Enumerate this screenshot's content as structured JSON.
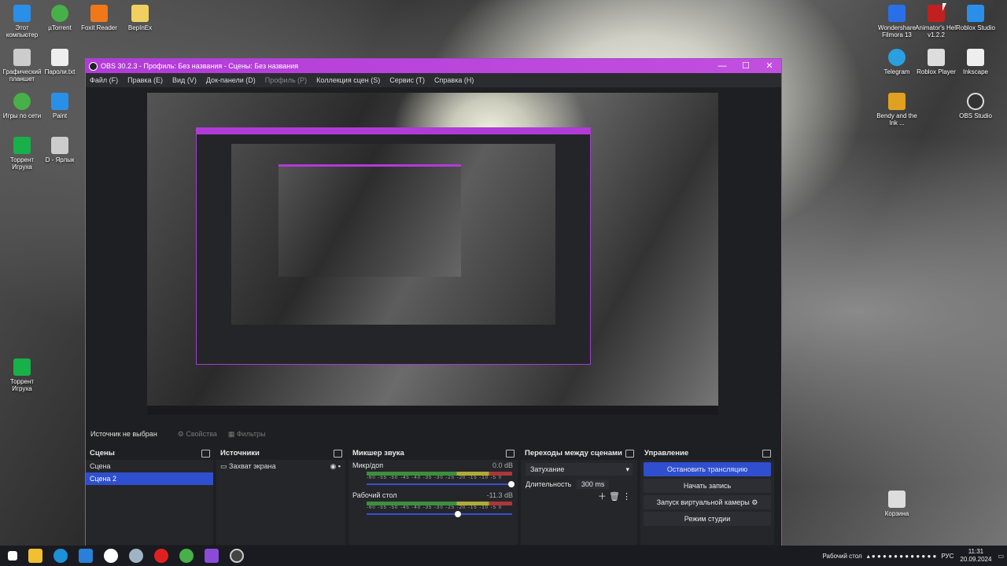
{
  "desktop": {
    "icons_left": [
      {
        "label": "Этот компьютер",
        "color": "#2a8fe8"
      },
      {
        "label": "µTorrent",
        "color": "#48b048"
      },
      {
        "label": "Foxit Reader",
        "color": "#f07818"
      },
      {
        "label": "BepInEx",
        "color": "#f0d060"
      },
      {
        "label": "Графический планшет",
        "color": "#cccccc"
      },
      {
        "label": "Пароли.txt",
        "color": "#eeeeee"
      },
      {
        "label": "Игры по сети",
        "color": "#48b048"
      },
      {
        "label": "Paint",
        "color": "#2a8fe8"
      },
      {
        "label": "Торрент Игруха",
        "color": "#18b048"
      },
      {
        "label": "D - Ярлык",
        "color": "#cccccc"
      },
      {
        "label": "Торрент Игруха",
        "color": "#18b048"
      }
    ],
    "icons_right": [
      {
        "label": "Wondershare Filmora 13",
        "color": "#2a6fe8"
      },
      {
        "label": "Animator's Hell v1.2.2",
        "color": "#c02020"
      },
      {
        "label": "Roblox Studio",
        "color": "#2a8fe8"
      },
      {
        "label": "Telegram",
        "color": "#2aa0e0"
      },
      {
        "label": "Roblox Player",
        "color": "#dddddd"
      },
      {
        "label": "Inkscape",
        "color": "#eeeeee"
      },
      {
        "label": "Bendy and the Ink ...",
        "color": "#e0a020"
      },
      {
        "label": "OBS Studio",
        "color": "#333333"
      },
      {
        "label": "Корзина",
        "color": "#dddddd"
      }
    ]
  },
  "window": {
    "title": "OBS 30.2.3 - Профиль: Без названия - Сцены: Без названия",
    "minimize": "—",
    "maximize": "☐",
    "close": "✕",
    "menu": [
      {
        "label": "Файл (F)",
        "dim": false
      },
      {
        "label": "Правка (E)",
        "dim": false
      },
      {
        "label": "Вид (V)",
        "dim": false
      },
      {
        "label": "Док-панели (D)",
        "dim": false
      },
      {
        "label": "Профиль (P)",
        "dim": true
      },
      {
        "label": "Коллекция сцен (S)",
        "dim": false
      },
      {
        "label": "Сервис (T)",
        "dim": false
      },
      {
        "label": "Справка (H)",
        "dim": false
      }
    ]
  },
  "status": {
    "source": "Источник не выбран",
    "properties": "Свойства",
    "filters": "Фильтры"
  },
  "scenes": {
    "title": "Сцены",
    "items": [
      "Сцена",
      "Сцена 2"
    ],
    "selected_index": 1
  },
  "sources": {
    "title": "Источники",
    "items": [
      "Захват экрана"
    ]
  },
  "mixer": {
    "title": "Микшер звука",
    "channels": [
      {
        "name": "Микр/доп",
        "db": "0.0 dB",
        "level": 0.72,
        "volume": 0.97
      },
      {
        "name": "Рабочий стол",
        "db": "-11.3 dB",
        "level": 0.63,
        "volume": 0.62
      }
    ],
    "ticks": "-60 -55 -50 -45 -40 -35 -30 -25 -20 -15 -10 -5 0"
  },
  "transitions": {
    "title": "Переходы между сценами",
    "selected": "Затухание",
    "duration_label": "Длительность",
    "duration_value": "300 ms"
  },
  "controls": {
    "title": "Управление",
    "stop_stream": "Остановить трансляцию",
    "start_record": "Начать запись",
    "virtual_cam": "Запуск виртуальной камеры",
    "studio_mode": "Режим студии"
  },
  "taskbar": {
    "apps": [
      {
        "name": "start",
        "color": "#ffffff"
      },
      {
        "name": "explorer",
        "color": "#f0c030"
      },
      {
        "name": "edge",
        "color": "#1e90d8"
      },
      {
        "name": "store",
        "color": "#2a7fd8"
      },
      {
        "name": "yandex-browser",
        "color": "#ffffff"
      },
      {
        "name": "steam",
        "color": "#9fb4c4"
      },
      {
        "name": "yandex",
        "color": "#e02020"
      },
      {
        "name": "utorrent",
        "color": "#48b048"
      },
      {
        "name": "animator",
        "color": "#8a4cd8"
      },
      {
        "name": "obs",
        "color": "#444444"
      }
    ],
    "desktop_label": "Рабочий стол",
    "lang": "РУС",
    "time": "11:31",
    "date": "20.09.2024"
  }
}
